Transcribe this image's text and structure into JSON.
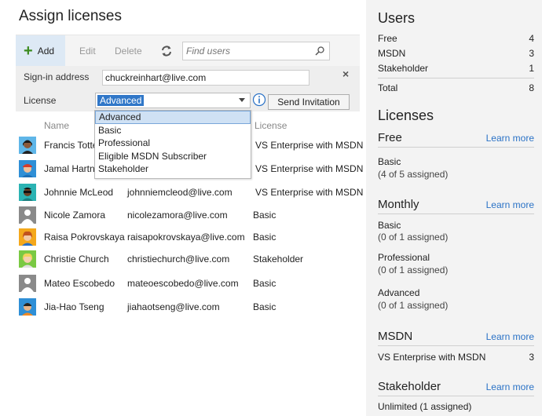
{
  "page_title": "Assign licenses",
  "toolbar": {
    "add_label": "Add",
    "edit_label": "Edit",
    "delete_label": "Delete",
    "search_placeholder": "Find users"
  },
  "form": {
    "signin_label": "Sign-in address",
    "signin_value": "chuckreinhart@live.com",
    "license_label": "License",
    "license_value": "Advanced",
    "invite_label": "Send Invitation",
    "close_label": "×"
  },
  "dropdown": {
    "options": [
      "Advanced",
      "Basic",
      "Professional",
      "Eligible MSDN Subscriber",
      "Stakeholder"
    ]
  },
  "table": {
    "headers": {
      "name": "Name",
      "license": "License"
    },
    "rows": [
      {
        "name": "Francis Totten",
        "email": "",
        "license": "VS Enterprise with MSDN",
        "avatar": "avatar-dark-hair"
      },
      {
        "name": "Jamal Hartnett",
        "email": "",
        "license": "VS Enterprise with MSDN",
        "avatar": "avatar-red-cap"
      },
      {
        "name": "Johnnie McLeod",
        "email": "johnniemcleod@live.com",
        "license": "VS Enterprise with MSDN",
        "avatar": "avatar-sunglasses"
      },
      {
        "name": "Nicole Zamora",
        "email": "nicolezamora@live.com",
        "license": "Basic",
        "avatar": "avatar-placeholder"
      },
      {
        "name": "Raisa Pokrovskaya",
        "email": "raisapokrovskaya@live.com",
        "license": "Basic",
        "avatar": "avatar-orange-hair"
      },
      {
        "name": "Christie Church",
        "email": "christiechurch@live.com",
        "license": "Stakeholder",
        "avatar": "avatar-blonde"
      },
      {
        "name": "Mateo Escobedo",
        "email": "mateoescobedo@live.com",
        "license": "Basic",
        "avatar": "avatar-placeholder"
      },
      {
        "name": "Jia-Hao Tseng",
        "email": "jiahaotseng@live.com",
        "license": "Basic",
        "avatar": "avatar-orange-shirt"
      }
    ]
  },
  "sidebar": {
    "users_title": "Users",
    "users": [
      {
        "label": "Free",
        "value": "4"
      },
      {
        "label": "MSDN",
        "value": "3"
      },
      {
        "label": "Stakeholder",
        "value": "1"
      }
    ],
    "total": {
      "label": "Total",
      "value": "8"
    },
    "licenses_title": "Licenses",
    "learn_more": "Learn more",
    "free": {
      "title": "Free",
      "items": [
        {
          "name": "Basic",
          "detail": "(4 of 5 assigned)"
        }
      ]
    },
    "monthly": {
      "title": "Monthly",
      "items": [
        {
          "name": "Basic",
          "detail": "(0 of 1 assigned)"
        },
        {
          "name": "Professional",
          "detail": "(0 of 1 assigned)"
        },
        {
          "name": "Advanced",
          "detail": "(0 of 1 assigned)"
        }
      ]
    },
    "msdn": {
      "title": "MSDN",
      "item": {
        "name": "VS Enterprise with MSDN",
        "value": "3"
      }
    },
    "stakeholder": {
      "title": "Stakeholder",
      "item": {
        "name": "Unlimited (1 assigned)"
      }
    }
  },
  "colors": {
    "accent": "#2a72c6",
    "add_icon": "#3c8b1f",
    "selection": "#3077c8",
    "sidebar_bg": "#f3f3f3"
  }
}
